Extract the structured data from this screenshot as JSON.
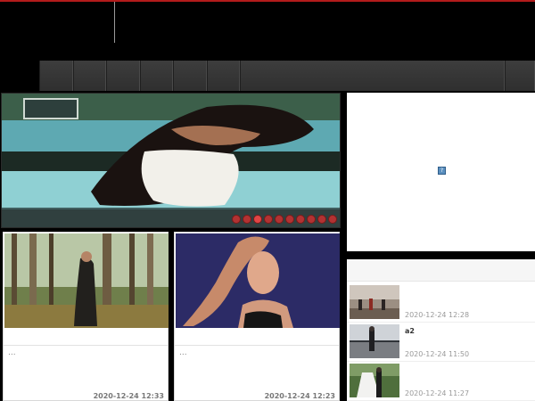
{
  "header": {
    "accent_color": "#b31b1b"
  },
  "nav": {
    "items": [
      "",
      "",
      "",
      "",
      "",
      "",
      ""
    ]
  },
  "slider": {
    "image_icon": "slideshow-photo",
    "dots_total": 10,
    "active_dot": 3
  },
  "side_box": {
    "broken_image_icon": "broken-image-icon"
  },
  "cards": [
    {
      "ellipsis": "...",
      "date": "2020-12-24 12:33",
      "thumb_icon": "forest-photo"
    },
    {
      "ellipsis": "...",
      "date": "2020-12-24 12:23",
      "thumb_icon": "portrait-photo"
    }
  ],
  "side_list": {
    "items": [
      {
        "title": "",
        "date": "2020-12-24 12:28",
        "thumb_icon": "street-photo"
      },
      {
        "title": "a2",
        "date": "2020-12-24 11:50",
        "thumb_icon": "pier-photo"
      },
      {
        "title": "",
        "date": "2020-12-24 11:27",
        "thumb_icon": "couple-photo"
      }
    ]
  }
}
